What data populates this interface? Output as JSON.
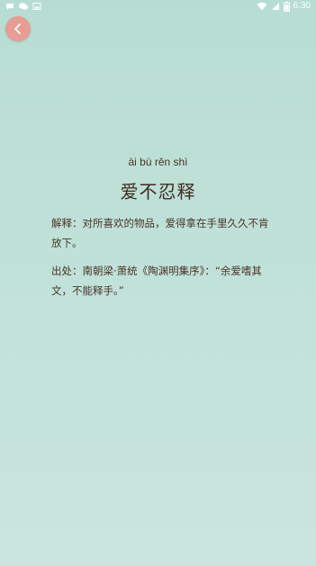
{
  "status_bar": {
    "time": "6:30"
  },
  "back_button": {
    "icon": "chevron-left-icon",
    "color": "#e79c94"
  },
  "idiom": {
    "pinyin": "ài bù rěn shì",
    "word": "爱不忍释"
  },
  "explanation": {
    "text": "解释：对所喜欢的物品，爱得拿在手里久久不肯放下。"
  },
  "source": {
    "text": "出处：南朝梁·萧统《陶渊明集序》：“余爱嗜其文，不能释手。”"
  },
  "colors": {
    "background": "#bfe0d8",
    "text": "#4a3428",
    "accent": "#e79c94"
  }
}
